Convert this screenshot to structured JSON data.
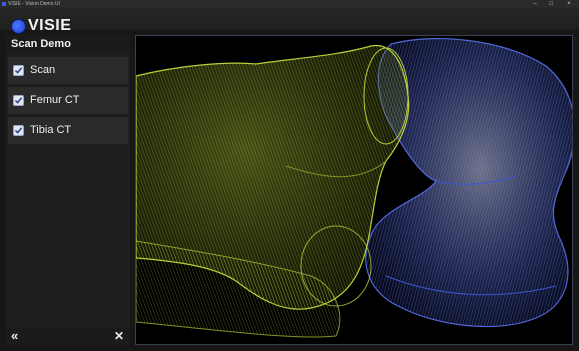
{
  "window": {
    "title": "VISIE - Vision Demo UI",
    "minimize_icon": "minimize-icon",
    "maximize_icon": "maximize-icon",
    "close_icon": "close-icon"
  },
  "header": {
    "logo_text": "VISIE",
    "logo_icon": "circle-logo-icon",
    "accent_color": "#2f55ea"
  },
  "panel": {
    "title": "Scan Demo",
    "layers": [
      {
        "label": "Scan",
        "checked": true
      },
      {
        "label": "Femur CT",
        "checked": true
      },
      {
        "label": "Tibia CT",
        "checked": true
      }
    ],
    "footer": {
      "collapse_symbol": "«",
      "close_symbol": "✕"
    }
  },
  "viewport": {
    "femur_color": "#b9cf3a",
    "tibia_color": "#4f66d8",
    "background": "#000000"
  }
}
